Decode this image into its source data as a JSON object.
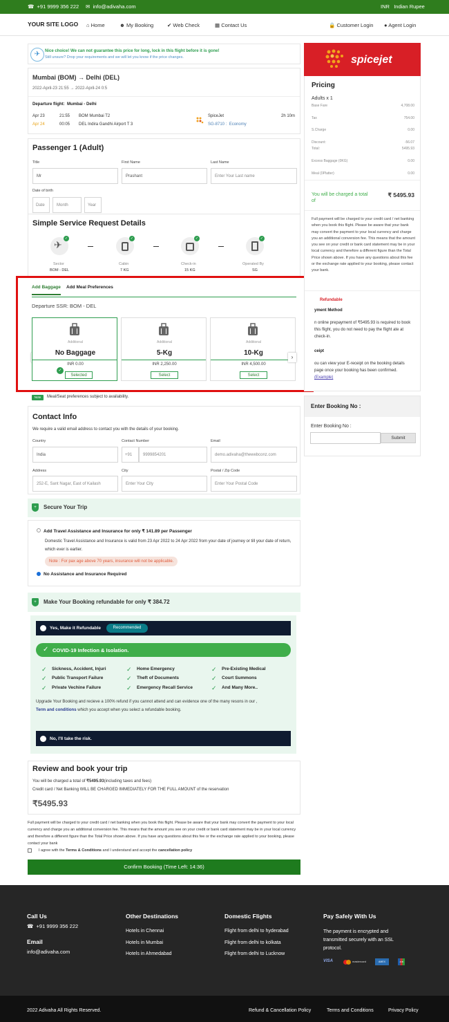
{
  "topbar": {
    "phone": "+91 9999 356 222",
    "email": "info@adivaha.com",
    "currency": "INR",
    "currency_name": "Indian Rupee"
  },
  "nav": {
    "logo": "YOUR SITE LOGO",
    "home": "Home",
    "my_booking": "My Booking",
    "web_check": "Web Check",
    "contact": "Contact Us",
    "customer_login": "Customer Login",
    "agent_login": "Agent Login"
  },
  "notice": {
    "title": "Nice choice! We can not guarantee this price for long, lock in this flight before it is gone!",
    "sub": "Still unsure? Drop your requirements and we will let you know if the price changes."
  },
  "flight": {
    "route": "Mumbai (BOM) → Delhi (DEL)",
    "dates": "2022-April-23 21:55  →  2022-April-24 0:5",
    "departure_label": "Departure flight:",
    "departure_route": "Mumbai  -  Delhi",
    "dep_date": "Apr 23",
    "dep_time": "21:55",
    "dep_airport": "BOM Mumbai T2",
    "arr_date": "Apr 24",
    "arr_time": "00:05",
    "arr_airport": "DEL Indira Gandhi Airport T 3",
    "airline": "SpiceJet",
    "code": "SG-8710",
    "cabin": "Economy",
    "duration": "2h 10m"
  },
  "passenger": {
    "title": "Passenger 1 (Adult)",
    "title_label": "Title",
    "title_value": "Mr",
    "first_label": "First Name",
    "first_value": "Prashant",
    "last_label": "Last Name",
    "last_placeholder": "Enter Your Last name",
    "dob_label": "Date of birth",
    "date": "Date",
    "month": "Month",
    "year": "Year"
  },
  "ssr": {
    "title": "Simple Service Request Details",
    "steps": [
      {
        "label": "Sector",
        "value": "BOM - DEL"
      },
      {
        "label": "Cabin",
        "value": "7 KG"
      },
      {
        "label": "Check-in",
        "value": "15 KG"
      },
      {
        "label": "Operated By",
        "value": "SG"
      }
    ],
    "tab_baggage": "Add Baggage",
    "tab_meal": "Add Meal Preferences",
    "departure": "Departure SSR: BOM - DEL",
    "options": [
      {
        "additional": "Additional",
        "name": "No Baggage",
        "price": "INR 0.00",
        "button": "Selected"
      },
      {
        "additional": "Additional",
        "name": "5-Kg",
        "price": "INR 2,250.00",
        "button": "Select"
      },
      {
        "additional": "Additional",
        "name": "10-Kg",
        "price": "INR 4,500.00",
        "button": "Select"
      }
    ],
    "note_badge": "Note",
    "note": "Meal/Seat preferences subject to availability."
  },
  "contact": {
    "title": "Contact Info",
    "sub": "We require a valid email address to contact you with the details of your booking.",
    "country_label": "Country",
    "country": "India",
    "number_label": "Contact Number",
    "code": "+91",
    "number": "9999854201",
    "email_label": "Email",
    "email": "demo.adivaha@thewebconz.com",
    "address_label": "Address",
    "address": "252-E, Sant Nagar, East of Kailash",
    "city_label": "City",
    "city": "Enter Your City",
    "postal_label": "Postal / Zip Code",
    "postal": "Enter Your Postal Code"
  },
  "secure": {
    "title": "Secure Your Trip",
    "opt1": "Add Travel Assistance and Insurance for only ₹ 141.89 per Passenger",
    "desc": "Domestic Travel Assistance and Insurance is valid from 23 Apr 2022 to 24 Apr 2022 from your date of journey or till your date of return, which ever is earlier.",
    "note": "Note : For pax age above 70 years, insurance will not be applicable.",
    "opt2": "No Assistance and Insurance Required"
  },
  "refund": {
    "title": "Make Your Booking refundable for only  ₹ 384.72",
    "yes": "Yes, Make it Refundable",
    "recommended": "Recommended",
    "covid": "COVID-19 Infection & Isolation.",
    "items": [
      "Sickness, Accident, Injuri",
      "Home Emergency",
      "Pre-Existing Medical",
      "Public Transport Failure",
      "Theft of Documents",
      "Court Summons",
      "Private Vechine Failure",
      "Emergency Recall Service",
      "And Many More.."
    ],
    "upgrade": "Upgrade Your Booking and recieve a 100% refund if you cannot attend and can evidence one of the many resons in our ,",
    "terms": "Term and conditions",
    "terms_after": " which you accept when you select a refundable booking.",
    "no": "No, I'll take the risk."
  },
  "review": {
    "title": "Review and book your trip",
    "line1_pre": "You will be charged a total of ",
    "line1_amount": "₹5495.93",
    "line1_post": "(including taxes and fees)",
    "line2": "Credit card / Net Banking WILL BE CHARGED IMMEDIATELY FOR THE FULL AMOUNT of the reservation",
    "total": "₹5495.93",
    "disclaimer": "Full payment will be charged to your credit card / net banking when you book this flight. Please be aware that your bank may convert the payment to your local currency and charge you an additional conversion fee. This means that the amount you see on your credit or bank card statement may be in your local currency and therefore a different figure than the Total Price shown above. If you have any questions about this fee or the exchange rate applied to your booking, please contact your bank",
    "agree_pre": "I agree with the ",
    "agree_terms": "Terms & Conditions",
    "agree_mid": " and I understand and accept the ",
    "agree_policy": "cancellation policy",
    "confirm": "Confirm Booking (Time Left: 14:36)"
  },
  "pricing": {
    "airline_logo": "spicejet",
    "title": "Pricing",
    "adults": "Adults x 1",
    "rows": [
      {
        "k": "Base Fare",
        "v": "4,708.00"
      },
      {
        "k": "Tax",
        "v": "754.00"
      },
      {
        "k": "S.Charge",
        "v": "0.00"
      },
      {
        "k": "Discount:",
        "v": "-56.07"
      },
      {
        "k": "Total:",
        "v": "5495.93"
      },
      {
        "k": "Excess Baggage (0KG)",
        "v": "0.00"
      },
      {
        "k": "Meal (0Platter)",
        "v": "0.00"
      }
    ],
    "charged_label": "You will be charged a total of",
    "charged": "₹ 5495.93",
    "info": "Full payment will be charged to your credit card / net banking when you book this flight. Please be aware that your bank may convert the payment to your local currency and charge you an additional conversion fee. This means that the amount you see on your credit or bank card statement may be in your local currency and therefore a different figure than the Total Price shown above. If you have any questions about this fee or the exchange rate applied to your booking, please contact your bank.",
    "refundable": "Refundable",
    "payment_method": "yment Method",
    "payment_text": "n online prepayment of ₹5495.93 is required to book this flight, you do not need to pay the flight ate at check-in.",
    "receipt": "ceipt",
    "receipt_text": "ou can view your E-receipt on the booking details page once your booking has been confirmed.",
    "example": "(Example)"
  },
  "booking_no": {
    "title": "Enter Booking No :",
    "label": "Enter Booking No :",
    "submit": "Submit"
  },
  "footer": {
    "call_title": "Call Us",
    "phone": "+91 9999 356 222",
    "email_title": "Email",
    "email": "info@adivaha.com",
    "dest_title": "Other Destinations",
    "dest": [
      "Hotels in Chennai",
      "Hotels in Mumbai",
      "Hotels in Ahmedabad"
    ],
    "dom_title": "Domestic Flights",
    "dom": [
      "Flight from delhi to hyderabad",
      "Flight from delhi to kolkata",
      "Flight from delhi to Lucknow"
    ],
    "pay_title": "Pay Safely With Us",
    "pay_text": "The payment is encrypted and transmitted securely with an SSL protocol.",
    "cards": [
      "VISA",
      "mastercard",
      "AMEX",
      "JCB"
    ],
    "copyright": "2022 Adivaha All Rights Reserved.",
    "links": [
      "Refund & Cancellation Policy",
      "Terms and Conditions",
      "Privacy Policy"
    ]
  }
}
